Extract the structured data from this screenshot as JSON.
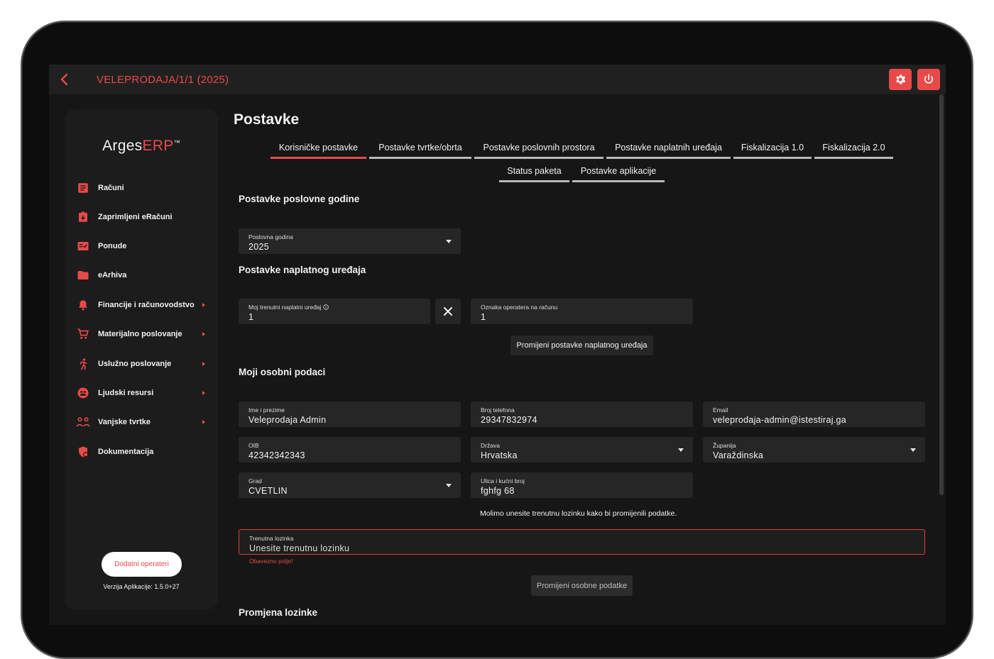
{
  "header": {
    "title": "VELEPRODAJA/1/1 (2025)"
  },
  "colors": {
    "accent": "#e84a4a",
    "background": "#161616",
    "panel": "#1c1c1c",
    "field": "#262626"
  },
  "sidebar": {
    "logo_main": "Arges",
    "logo_accent": "ERP",
    "logo_tm": "™",
    "items": [
      {
        "label": "Računi",
        "icon": "invoice-icon",
        "has_submenu": false
      },
      {
        "label": "Zaprimljeni eRačuni",
        "icon": "received-invoice-icon",
        "has_submenu": false
      },
      {
        "label": "Ponude",
        "icon": "offers-icon",
        "has_submenu": false
      },
      {
        "label": "eArhiva",
        "icon": "folder-icon",
        "has_submenu": false
      },
      {
        "label": "Financije i računovodstvo",
        "icon": "bell-icon",
        "has_submenu": true
      },
      {
        "label": "Materijalno poslovanje",
        "icon": "cart-icon",
        "has_submenu": true
      },
      {
        "label": "Uslužno poslovanje",
        "icon": "runner-icon",
        "has_submenu": true
      },
      {
        "label": "Ljudski resursi",
        "icon": "people-icon",
        "has_submenu": true
      },
      {
        "label": "Vanjske tvrtke",
        "icon": "handshake-icon",
        "has_submenu": true
      },
      {
        "label": "Dokumentacija",
        "icon": "shield-doc-icon",
        "has_submenu": false
      }
    ],
    "operators_button": "Dodatni operateri",
    "version": "Verzija Aplikacije: 1.5.0+27"
  },
  "main": {
    "title": "Postavke",
    "tabs": [
      {
        "label": "Korisničke postavke",
        "active": true
      },
      {
        "label": "Postavke tvrtke/obrta",
        "active": false
      },
      {
        "label": "Postavke poslovnih prostora",
        "active": false
      },
      {
        "label": "Postavke naplatnih uređaja",
        "active": false
      },
      {
        "label": "Fiskalizacija 1.0",
        "active": false
      },
      {
        "label": "Fiskalizacija 2.0",
        "active": false
      },
      {
        "label": "Status paketa",
        "active": false
      },
      {
        "label": "Postavke aplikacije",
        "active": false
      }
    ],
    "business_year": {
      "heading": "Postavke poslovne godine",
      "field_label": "Poslovna godina",
      "value": "2025"
    },
    "payment_device": {
      "heading": "Postavke naplatnog uređaja",
      "device_label": "Moj trenutni naplatni uređaj",
      "device_value": "1",
      "operator_label": "Oznaka operatera na računu",
      "operator_value": "1",
      "button": "Promijeni postavke naplatnog uređaja"
    },
    "personal": {
      "heading": "Moji osobni podaci",
      "name_label": "Ime i prezime",
      "name_value": "Veleprodaja Admin",
      "phone_label": "Broj telefona",
      "phone_value": "29347832974",
      "email_label": "Email",
      "email_value": "veleprodaja-admin@istestiraj.ga",
      "oib_label": "OIB",
      "oib_value": "42342342343",
      "country_label": "Država",
      "country_value": "Hrvatska",
      "county_label": "Županija",
      "county_value": "Varaždinska",
      "city_label": "Grad",
      "city_value": "CVETLIN",
      "street_label": "Ulica i kućni broj",
      "street_value": "fghfg 68",
      "note": "Molimo unesite trenutnu lozinku kako bi promijenili podatke.",
      "password_label": "Trenutna lozinka",
      "password_placeholder": "Unesite trenutnu lozinku",
      "required_error": "Obavezno polje!",
      "button": "Promijeni osobne podatke"
    },
    "password_change": {
      "heading": "Promjena lozinke"
    }
  }
}
